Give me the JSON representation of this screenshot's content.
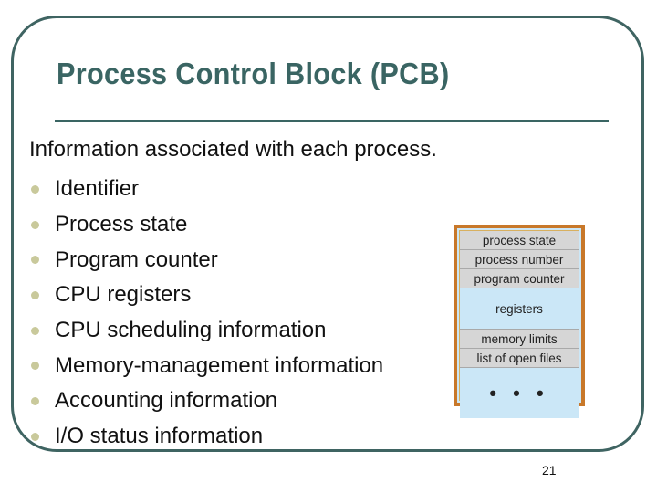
{
  "slide": {
    "title": "Process Control Block (PCB)",
    "intro": "Information associated with each process.",
    "bullets": [
      "Identifier",
      "Process state",
      "Program counter",
      "CPU registers",
      "CPU scheduling information",
      "Memory-management information",
      "Accounting information",
      "I/O status information"
    ],
    "page_number": "21"
  },
  "pcb_diagram": {
    "fields": [
      "process state",
      "process number",
      "program counter",
      "registers",
      "memory limits",
      "list of open files",
      "• • •"
    ]
  },
  "colors": {
    "title": "#3a6563",
    "frame": "#3f6462",
    "bullet": "#c9c99b",
    "pcb_border": "#c8782a",
    "pcb_blue": "#cbe7f7",
    "pcb_gray": "#d6d6d6"
  }
}
